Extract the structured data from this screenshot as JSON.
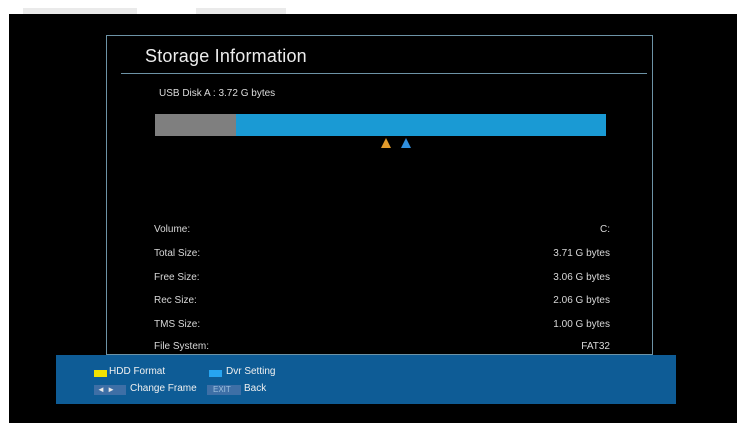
{
  "panel": {
    "title": "Storage Information",
    "disk_label": "USB Disk A : 3.72 G bytes",
    "usage_bar": {
      "used_fraction": 0.18,
      "used_color": "#7f7f7f",
      "free_color": "#1a9ad4"
    },
    "markers": [
      {
        "name": "orange-marker",
        "color": "#e29a2b"
      },
      {
        "name": "blue-marker",
        "color": "#2f8fe0"
      }
    ]
  },
  "info": [
    {
      "label": "Volume:",
      "value": "C:"
    },
    {
      "label": "Total Size:",
      "value": "3.71 G bytes"
    },
    {
      "label": "Free Size:",
      "value": "3.06 G bytes"
    },
    {
      "label": "Rec Size:",
      "value": "2.06 G bytes"
    },
    {
      "label": "TMS Size:",
      "value": "1.00 G bytes"
    },
    {
      "label": "File System:",
      "value": "FAT32"
    }
  ],
  "footer": {
    "hdd_format": "HDD Format",
    "dvr_setting": "Dvr Setting",
    "arrows_key": "◄ ►",
    "change_frame": "Change Frame",
    "exit_key": "EXIT",
    "back": "Back",
    "colors": {
      "yellow": "#f1e200",
      "blue": "#27a4f0",
      "footer_bg": "#0e5c96"
    }
  }
}
